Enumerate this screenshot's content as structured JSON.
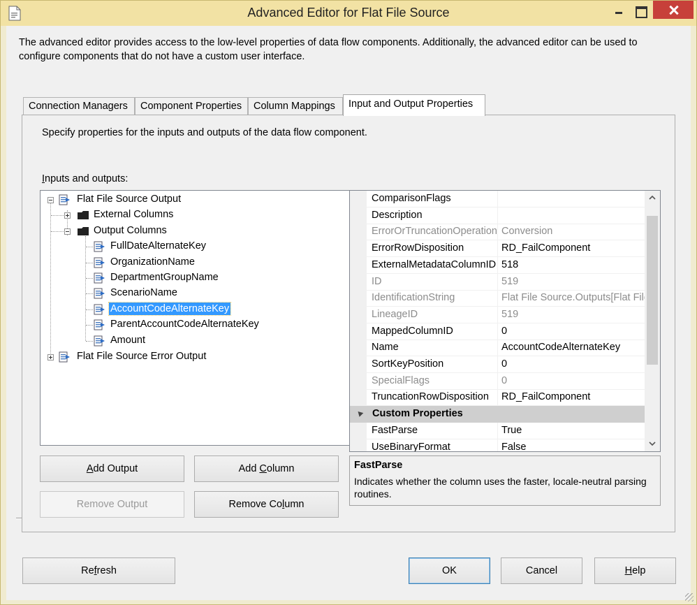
{
  "window": {
    "title": "Advanced Editor for Flat File Source",
    "description": "The advanced editor provides access to the low-level properties of data flow components. Additionally, the advanced editor can be used to configure components that do not have a custom user interface."
  },
  "tabs": [
    {
      "label": "Connection Managers"
    },
    {
      "label": "Component Properties"
    },
    {
      "label": "Column Mappings"
    },
    {
      "label": "Input and Output Properties",
      "active": true
    }
  ],
  "panel": {
    "description": "Specify properties for the inputs and outputs of the data flow component.",
    "io_label_underlined": "I",
    "io_label_rest": "nputs and outputs:"
  },
  "tree": {
    "output": "Flat File Source Output",
    "external_columns": "External Columns",
    "output_columns": "Output Columns",
    "columns": [
      "FullDateAlternateKey",
      "OrganizationName",
      "DepartmentGroupName",
      "ScenarioName",
      "AccountCodeAlternateKey",
      "ParentAccountCodeAlternateKey",
      "Amount"
    ],
    "selected_column": "AccountCodeAlternateKey",
    "error_output": "Flat File Source Error Output"
  },
  "buttons": {
    "add_output": {
      "u": "A",
      "rest": "dd Output"
    },
    "add_column_pre": "Add ",
    "add_column_u": "C",
    "add_column_post": "olumn",
    "remove_output": "Remove Output",
    "remove_column_pre": "Remove Co",
    "remove_column_u": "l",
    "remove_column_post": "umn",
    "refresh_pre": "Re",
    "refresh_u": "f",
    "refresh_post": "resh",
    "ok": "OK",
    "cancel": "Cancel",
    "help_u": "H",
    "help_rest": "elp"
  },
  "properties": [
    {
      "name": "ComparisonFlags",
      "value": "",
      "readonly": false
    },
    {
      "name": "Description",
      "value": "",
      "readonly": false
    },
    {
      "name": "ErrorOrTruncationOperation",
      "value": "Conversion",
      "readonly": true
    },
    {
      "name": "ErrorRowDisposition",
      "value": "RD_FailComponent",
      "readonly": false
    },
    {
      "name": "ExternalMetadataColumnID",
      "value": "518",
      "readonly": false
    },
    {
      "name": "ID",
      "value": "519",
      "readonly": true
    },
    {
      "name": "IdentificationString",
      "value": "Flat File Source.Outputs[Flat File",
      "readonly": true
    },
    {
      "name": "LineageID",
      "value": "519",
      "readonly": true
    },
    {
      "name": "MappedColumnID",
      "value": "0",
      "readonly": false
    },
    {
      "name": "Name",
      "value": "AccountCodeAlternateKey",
      "readonly": false
    },
    {
      "name": "SortKeyPosition",
      "value": "0",
      "readonly": false
    },
    {
      "name": "SpecialFlags",
      "value": "0",
      "readonly": true
    },
    {
      "name": "TruncationRowDisposition",
      "value": "RD_FailComponent",
      "readonly": false
    }
  ],
  "custom_category": "Custom Properties",
  "custom_properties": [
    {
      "name": "FastParse",
      "value": "True",
      "readonly": false
    },
    {
      "name": "UseBinaryFormat",
      "value": "False",
      "readonly": false
    }
  ],
  "help": {
    "title": "FastParse",
    "text": "Indicates whether the column uses the faster, locale-neutral parsing routines."
  },
  "colors": {
    "selection": "#3399ff",
    "titlebar": "#f2e2a4",
    "close_button": "#c7403a"
  }
}
